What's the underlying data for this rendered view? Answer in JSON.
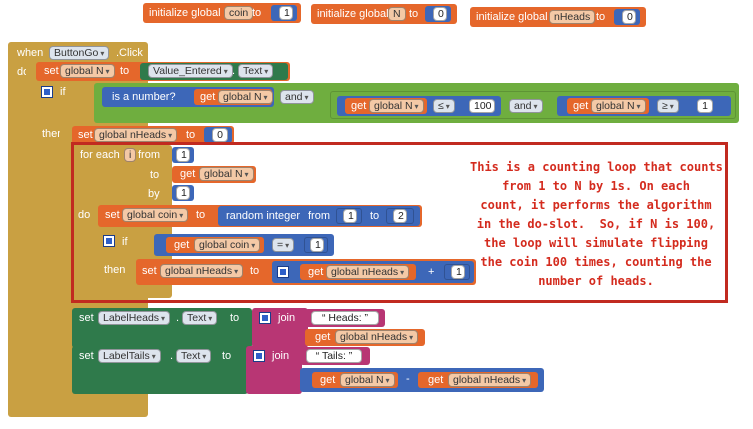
{
  "colors": {
    "variables": "#e5672b",
    "control": "#c9a042",
    "math": "#3d67b8",
    "logic": "#6fae3f",
    "text": "#b83674",
    "components": "#2f7a4b",
    "annotation_border": "#c12a20",
    "annotation_text": "#d42b1e"
  },
  "globals": [
    {
      "label": "initialize global",
      "name": "coin",
      "to": "to",
      "value": "1"
    },
    {
      "label": "initialize global",
      "name": "N",
      "to": "to",
      "value": "0"
    },
    {
      "label": "initialize global",
      "name": "nHeads",
      "to": "to",
      "value": "0"
    }
  ],
  "event": {
    "when": "when",
    "component": "ButtonGo",
    "event": ".Click",
    "do": "do"
  },
  "set_n": {
    "set": "set",
    "var": "global N",
    "to": "to",
    "component": "Value_Entered",
    "property": "Text"
  },
  "if_block": {
    "if": "if",
    "is_number": "is a number?",
    "get": "get",
    "var_n": "global N",
    "and1": "and",
    "and2": "and",
    "le": "≤",
    "limit": "100",
    "ge": "≥",
    "min": "1",
    "then": "then"
  },
  "reset_heads": {
    "set": "set",
    "var": "global nHeads",
    "to": "to",
    "value": "0"
  },
  "for_loop": {
    "for_each": "for each",
    "loop_var": "i",
    "from": "from",
    "from_value": "1",
    "to": "to",
    "to_get": "get",
    "to_var": "global N",
    "by": "by",
    "by_value": "1",
    "do": "do"
  },
  "set_coin": {
    "set": "set",
    "var": "global coin",
    "to": "to",
    "random": "random integer",
    "from": "from",
    "from_value": "1",
    "to2": "to",
    "to_value": "2"
  },
  "inner_if": {
    "if": "if",
    "get": "get",
    "var": "global coin",
    "eq": "=",
    "value": "1",
    "then": "then"
  },
  "inc_heads": {
    "set": "set",
    "var": "global nHeads",
    "to": "to",
    "get": "get",
    "get_var": "global nHeads",
    "plus": "+",
    "value": "1"
  },
  "set_heads_label": {
    "set": "set",
    "component": "LabelHeads",
    "property": "Text",
    "to": "to",
    "join": "join",
    "text": "Heads:",
    "get": "get",
    "var": "global nHeads"
  },
  "set_tails_label": {
    "set": "set",
    "component": "LabelTails",
    "property": "Text",
    "to": "to",
    "join": "join",
    "text": "Tails:",
    "get1": "get",
    "var1": "global N",
    "minus": "-",
    "get2": "get",
    "var2": "global nHeads"
  },
  "annotation": {
    "text": "This is a counting loop that counts\nfrom 1 to N by 1s. On each\ncount, it performs the algorithm\nin the do-slot.  So, if N is 100,\nthe loop will simulate flipping\nthe coin 100 times, counting the\nnumber of heads."
  }
}
